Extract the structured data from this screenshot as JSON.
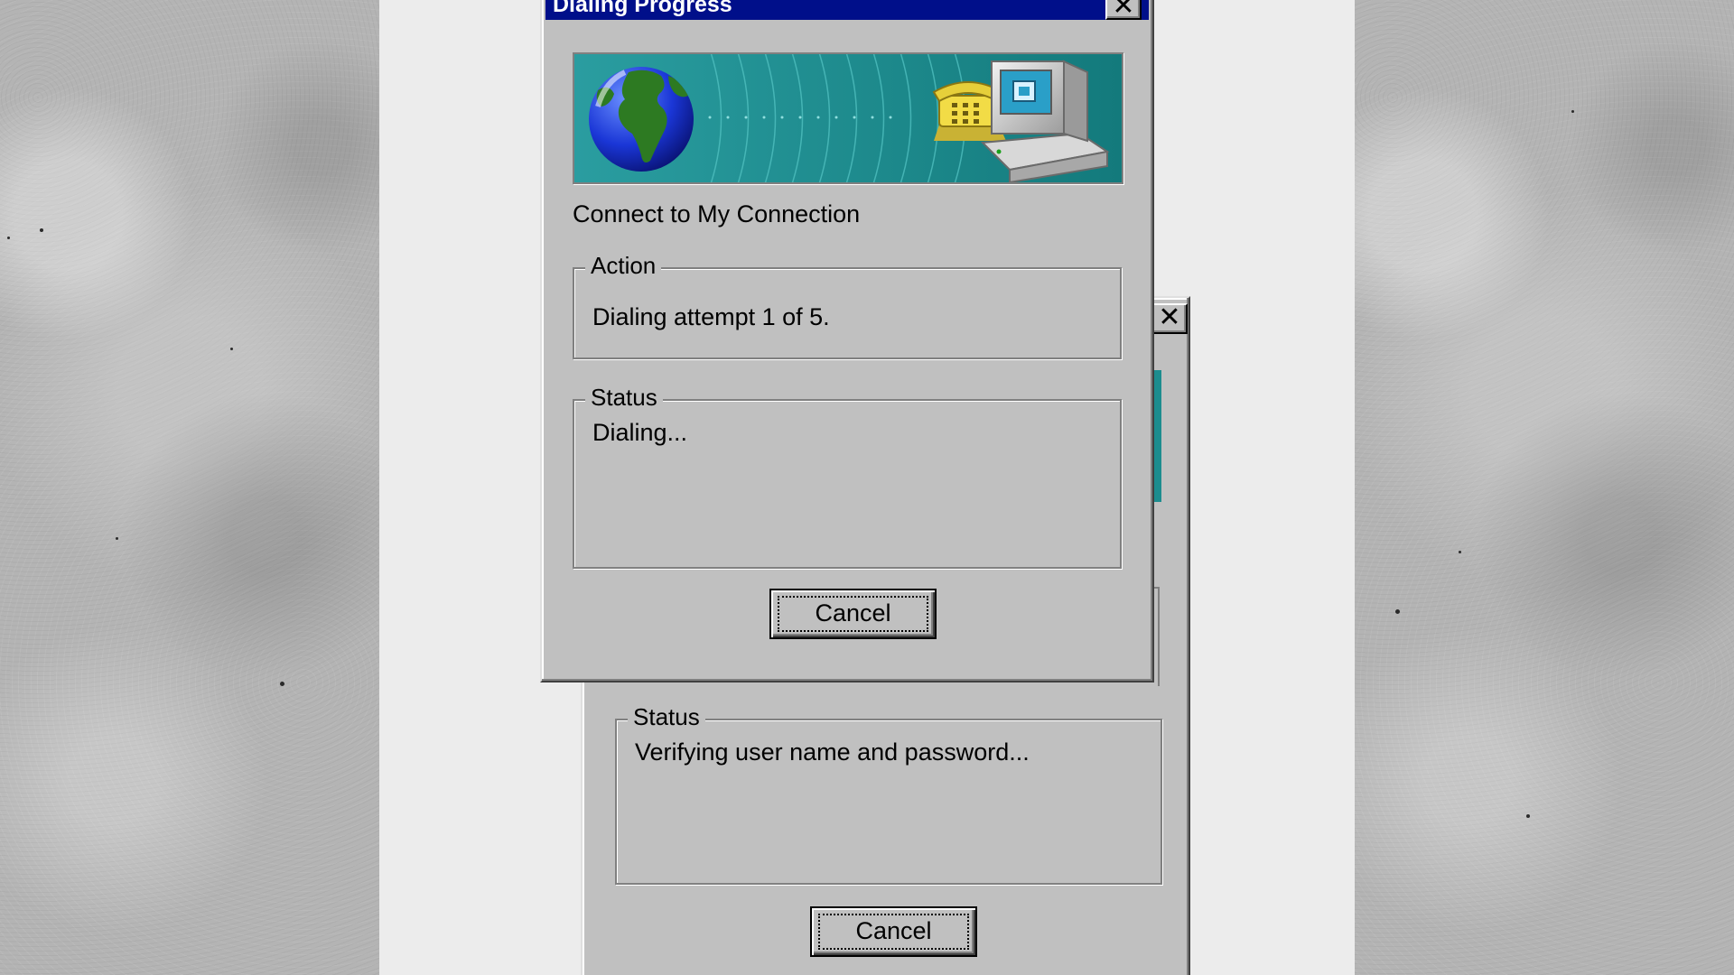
{
  "colors": {
    "window_face": "#c0c0c0",
    "title_bar": "#000f8a",
    "banner_teal": "#1c8c8e",
    "desktop": "#ececec"
  },
  "dialog_front": {
    "title": "Dialing Progress",
    "close_icon": "close-icon",
    "banner_icons": [
      "globe-icon",
      "telephone-icon",
      "computer-icon"
    ],
    "connect_label": "Connect to My Connection",
    "action_group": {
      "label": "Action",
      "text": "Dialing attempt 1 of 5."
    },
    "status_group": {
      "label": "Status",
      "text": "Dialing..."
    },
    "cancel_label": "Cancel"
  },
  "dialog_back": {
    "close_icon": "close-icon",
    "status_group": {
      "label": "Status",
      "text": "Verifying user name and password..."
    },
    "cancel_label": "Cancel"
  }
}
